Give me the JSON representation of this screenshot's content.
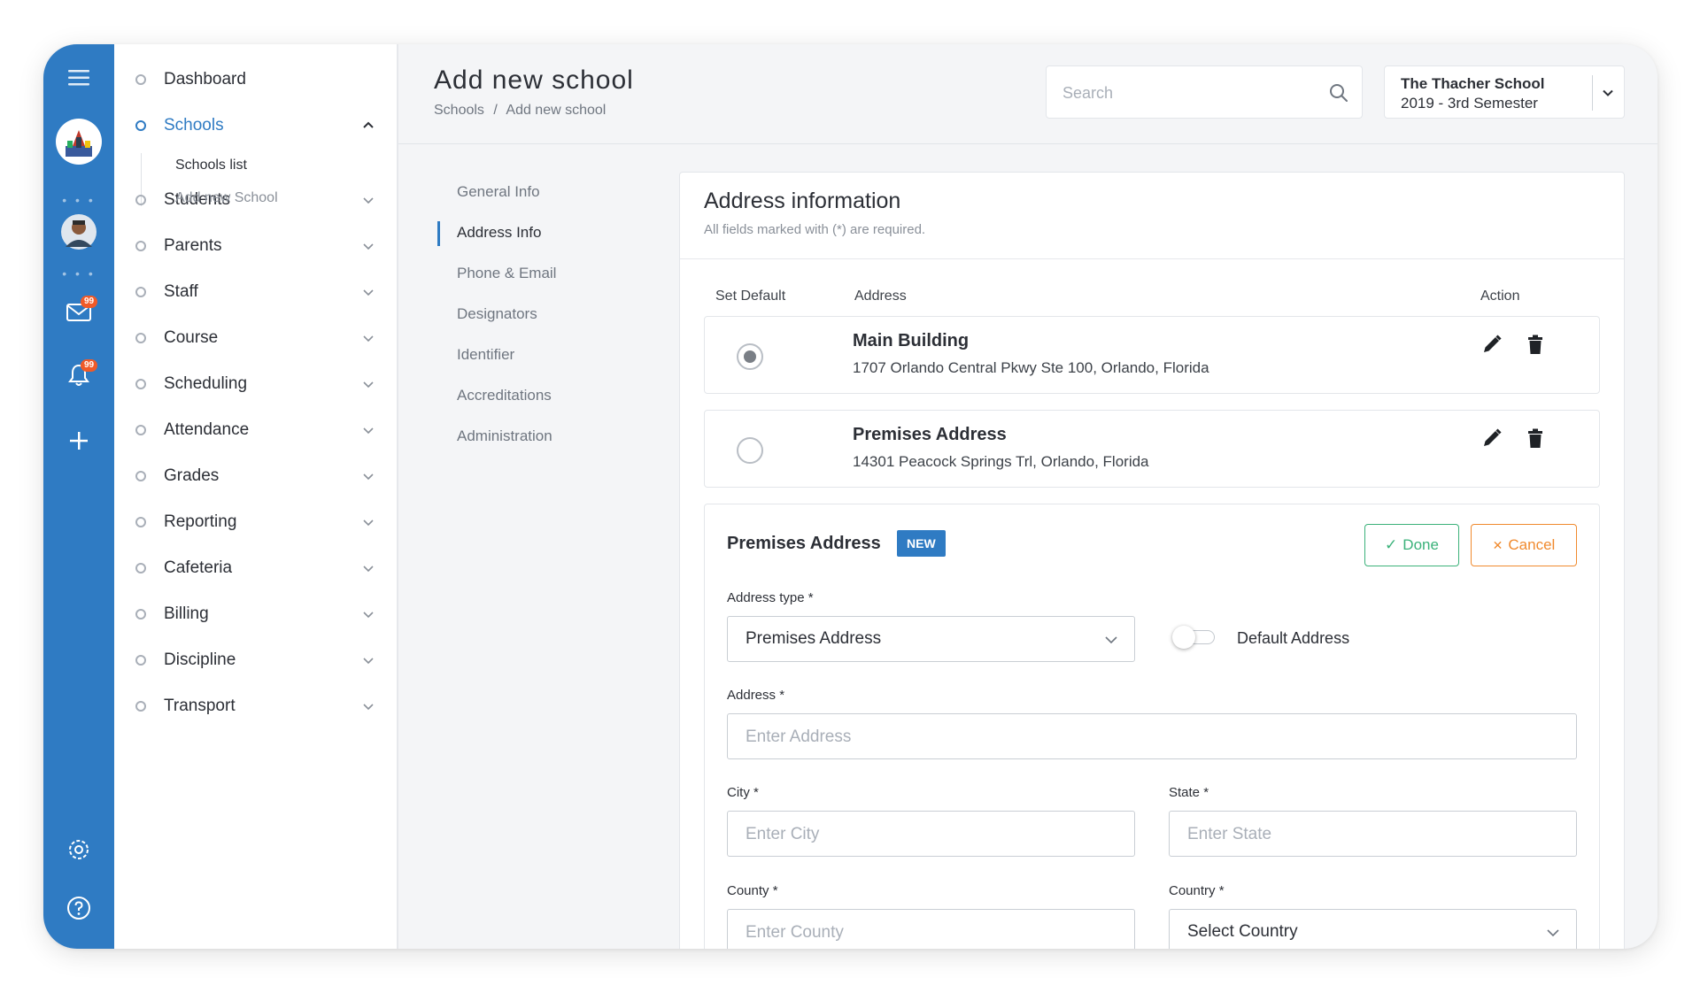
{
  "header": {
    "title": "Add new school",
    "breadcrumb": [
      "Schools",
      "/",
      "Add new school"
    ],
    "search_placeholder": "Search",
    "school_name": "The Thacher School",
    "school_term": "2019 - 3rd Semester"
  },
  "rail": {
    "mail_badge": "99",
    "bell_badge": "99"
  },
  "sidebar": {
    "items": [
      {
        "label": "Dashboard"
      },
      {
        "label": "Schools",
        "active": true
      },
      {
        "label": "Students"
      },
      {
        "label": "Parents"
      },
      {
        "label": "Staff"
      },
      {
        "label": "Course"
      },
      {
        "label": "Scheduling"
      },
      {
        "label": "Attendance"
      },
      {
        "label": "Grades"
      },
      {
        "label": "Reporting"
      },
      {
        "label": "Cafeteria"
      },
      {
        "label": "Billing"
      },
      {
        "label": "Discipline"
      },
      {
        "label": "Transport"
      }
    ],
    "sub_items": [
      {
        "label": "Schools list"
      },
      {
        "label": "Add new School"
      }
    ]
  },
  "section_nav": {
    "items": [
      {
        "label": "General Info"
      },
      {
        "label": "Address Info",
        "active": true
      },
      {
        "label": "Phone & Email"
      },
      {
        "label": "Designators"
      },
      {
        "label": "Identifier"
      },
      {
        "label": "Accreditations"
      },
      {
        "label": "Administration"
      }
    ]
  },
  "address_card": {
    "title": "Address information",
    "subtitle": "All fields marked with (*) are required.",
    "columns": {
      "set_default": "Set Default",
      "address": "Address",
      "action": "Action"
    },
    "rows": [
      {
        "name": "Main Building",
        "line": "1707 Orlando Central Pkwy Ste 100, Orlando, Florida",
        "default": true
      },
      {
        "name": "Premises Address",
        "line": "14301 Peacock Springs Trl, Orlando, Florida",
        "default": false
      }
    ]
  },
  "form": {
    "title": "Premises Address",
    "badge": "NEW",
    "done": "Done",
    "done_icon": "✓",
    "cancel": "Cancel",
    "cancel_icon": "✕",
    "address_type_label": "Address type *",
    "address_type_value": "Premises Address",
    "default_toggle_label": "Default Address",
    "default_toggle_on": false,
    "address_label": "Address *",
    "address_placeholder": "Enter Address",
    "city_label": "City *",
    "city_placeholder": "Enter City",
    "state_label": "State *",
    "state_placeholder": "Enter State",
    "county_label": "County *",
    "county_placeholder": "Enter County",
    "country_label": "Country *",
    "country_value": "Select Country"
  },
  "colors": {
    "primary": "#2f7bc3",
    "done": "#3bb27a",
    "cancel": "#f08a2e",
    "badge": "#f05a28"
  }
}
